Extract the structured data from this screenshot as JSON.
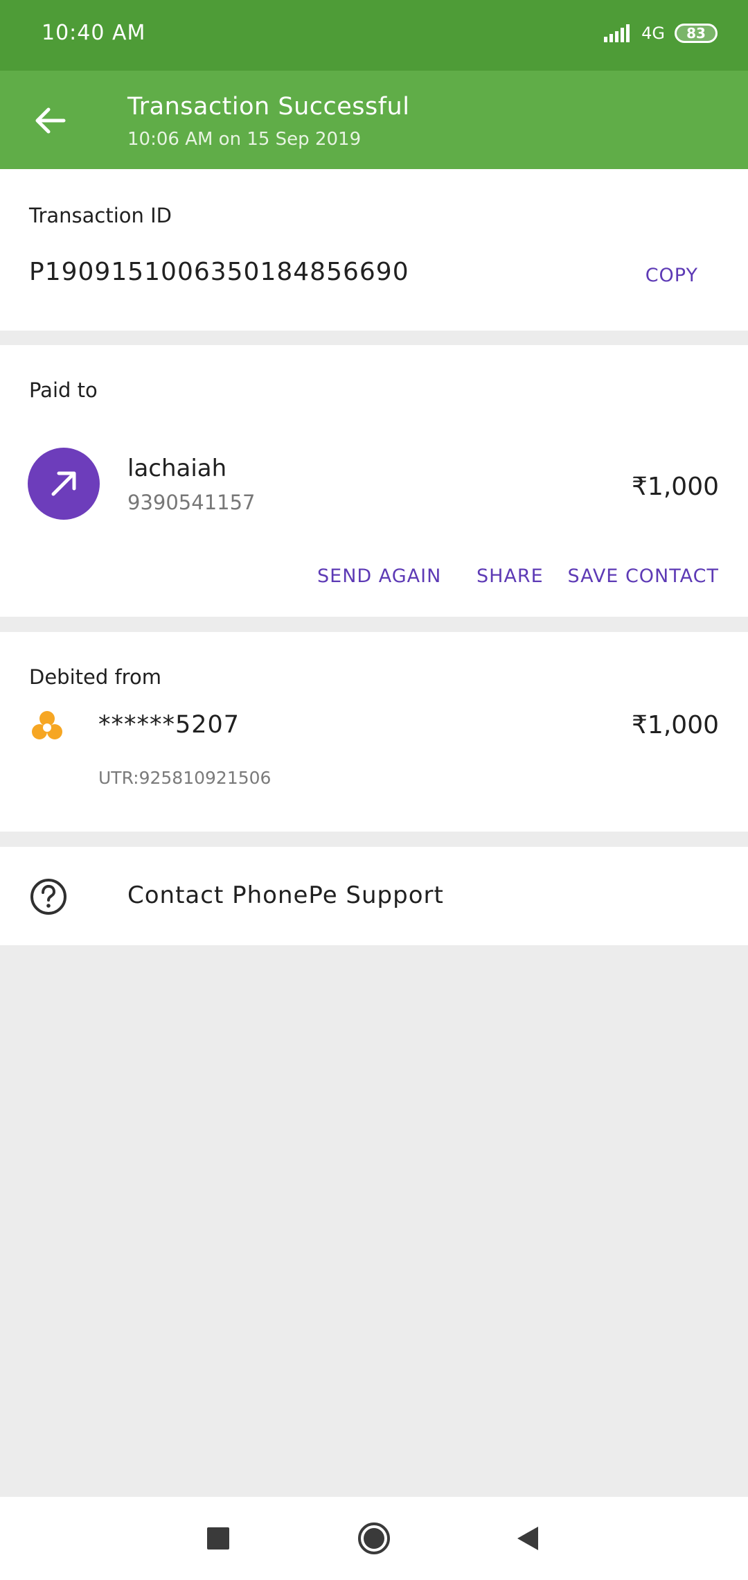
{
  "status_bar": {
    "time": "10:40 AM",
    "network": "4G",
    "battery": "83"
  },
  "header": {
    "title": "Transaction Successful",
    "subtitle": "10:06 AM on 15 Sep 2019",
    "back_icon": "arrow-left-icon"
  },
  "transaction": {
    "label": "Transaction ID",
    "id": "P1909151006350184856690",
    "copy_label": "COPY"
  },
  "paid_to": {
    "label": "Paid to",
    "name": "lachaiah",
    "phone": "9390541157",
    "amount": "₹1,000",
    "avatar_icon": "arrow-up-right-icon",
    "actions": {
      "send_again": "SEND AGAIN",
      "share": "SHARE",
      "save_contact": "SAVE CONTACT"
    }
  },
  "debited_from": {
    "label": "Debited from",
    "account": "******5207",
    "utr": "UTR:925810921506",
    "amount": "₹1,000",
    "bank_icon": "bank-logo-icon"
  },
  "support": {
    "label": "Contact PhonePe Support",
    "icon": "help-circle-icon"
  },
  "nav": {
    "recents_icon": "square-icon",
    "home_icon": "circle-icon",
    "back_icon": "triangle-back-icon"
  },
  "colors": {
    "status_bar": "#4e9c37",
    "app_bar": "#60ad48",
    "accent": "#5d3ab5",
    "avatar": "#6d3dbb",
    "bank_logo": "#f6a623"
  }
}
